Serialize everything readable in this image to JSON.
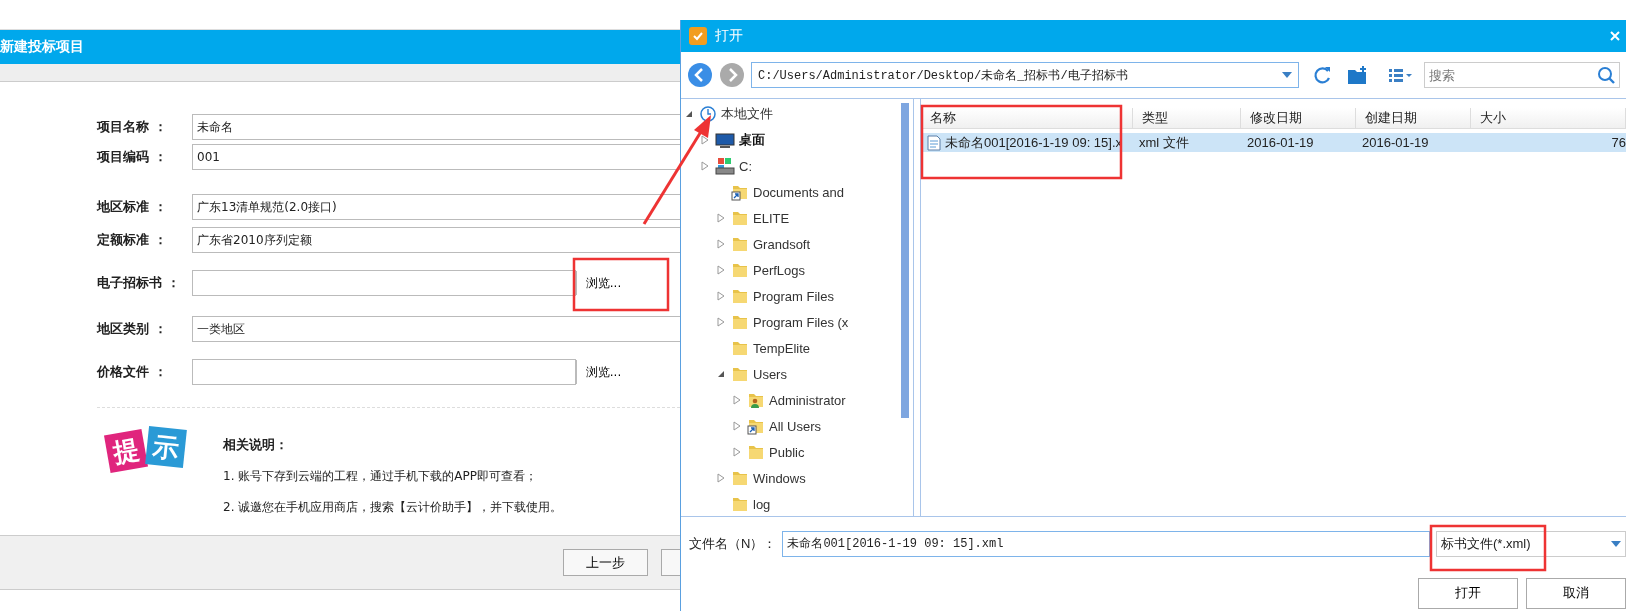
{
  "form_dialog": {
    "title": "新建投标项目",
    "fields": [
      {
        "label": "项目名称 ：",
        "kind": "text",
        "value": "未命名"
      },
      {
        "label": "项目编码 ：",
        "kind": "text",
        "value": "001"
      },
      {
        "label": "地区标准 ：",
        "kind": "text",
        "value": "广东13清单规范(2.0接口)"
      },
      {
        "label": "定额标准 ：",
        "kind": "text",
        "value": "广东省2010序列定额"
      },
      {
        "label": "电子招标书 ：",
        "kind": "file",
        "button": "浏览..."
      },
      {
        "label": "地区类别 ：",
        "kind": "text",
        "value": "一类地区"
      },
      {
        "label": "价格文件 ：",
        "kind": "file",
        "button": "浏览..."
      }
    ],
    "tip_logo": [
      "提",
      "示"
    ],
    "tips": {
      "title": "相关说明：",
      "items": [
        "1. 账号下存到云端的工程，通过手机下载的APP即可查看；",
        "2. 诚邀您在手机应用商店，搜索【云计价助手】，并下载使用。"
      ]
    },
    "buttons": [
      "上一步"
    ]
  },
  "open_dialog": {
    "title": "打开",
    "path": "C:/Users/Administrator/Desktop/未命名_招标书/电子招标书",
    "search": {
      "placeholder": "搜索"
    },
    "tree": [
      {
        "label": "本地文件",
        "kind": "location",
        "expanded": true,
        "children": [
          {
            "label": "桌面",
            "kind": "desktop",
            "expanded": false
          },
          {
            "label": "C:",
            "kind": "drive",
            "expanded": false,
            "children": [
              {
                "label": "Documents and",
                "kind": "shortcut"
              },
              {
                "label": "ELITE",
                "kind": "folder",
                "expanded": false
              },
              {
                "label": "Grandsoft",
                "kind": "folder",
                "expanded": false
              },
              {
                "label": "PerfLogs",
                "kind": "folder",
                "expanded": false
              },
              {
                "label": "Program Files",
                "kind": "folder",
                "expanded": false
              },
              {
                "label": "Program Files (x",
                "kind": "folder",
                "expanded": false
              },
              {
                "label": "TempElite",
                "kind": "folder"
              },
              {
                "label": "Users",
                "kind": "folder",
                "expanded": true,
                "children": [
                  {
                    "label": "Administrator",
                    "kind": "user",
                    "expanded": false
                  },
                  {
                    "label": "All Users",
                    "kind": "shortcut",
                    "expanded": false
                  },
                  {
                    "label": "Public",
                    "kind": "folder",
                    "expanded": false
                  }
                ]
              },
              {
                "label": "Windows",
                "kind": "folder",
                "expanded": false
              },
              {
                "label": "log",
                "kind": "folder"
              }
            ]
          }
        ]
      }
    ],
    "columns": [
      "名称",
      "类型",
      "修改日期",
      "创建日期",
      "大小"
    ],
    "rows": [
      {
        "cells": [
          "未命名001[2016-1-19 09: 15].x",
          "xml 文件",
          "2016-01-19",
          "2016-01-19",
          "76"
        ],
        "selected": true
      }
    ],
    "filename_label": "文件名（N）：",
    "filename": "未命名001[2016-1-19 09: 15].xml",
    "filter": "标书文件(*.xml)",
    "buttons": [
      "打开",
      "取消"
    ]
  }
}
